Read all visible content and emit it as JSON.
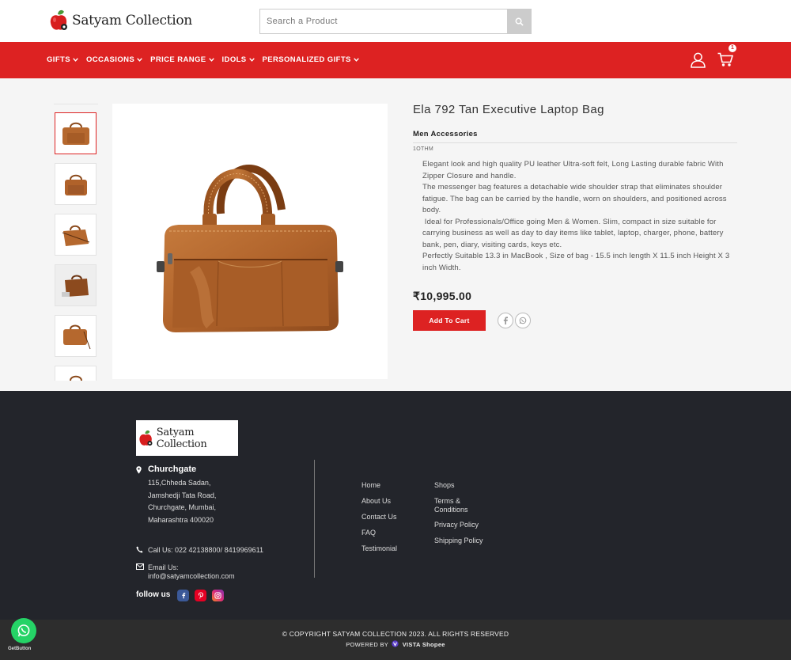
{
  "header": {
    "logo_text": "Satyam Collection",
    "search_placeholder": "Search a Product",
    "cart_count": "1"
  },
  "nav": {
    "items": [
      {
        "label": "GIFTS"
      },
      {
        "label": "OCCASIONS"
      },
      {
        "label": "PRICE RANGE"
      },
      {
        "label": "IDOLS"
      },
      {
        "label": "PERSONALIZED GIFTS"
      }
    ]
  },
  "product": {
    "title": "Ela 792 Tan Executive Laptop Bag",
    "category": "Men Accessories",
    "sku": "1OTHM",
    "description": [
      "Elegant look and high quality PU leather Ultra-soft felt, Long Lasting durable fabric With Zipper Closure and handle.",
      "The messenger bag features a detachable wide shoulder strap that eliminates shoulder fatigue. The bag can be carried by the handle, worn on shoulders, and positioned across body.",
      " Ideal for Professionals/Office going Men & Women. Slim, compact in size suitable for carrying business as well as day to day items like tablet, laptop, charger, phone, battery bank, pen, diary, visiting cards, keys etc.",
      "Perfectly Suitable 13.3 in MacBook , Size of bag - 15.5 inch length X 11.5 inch Height X 3 inch Width."
    ],
    "price": "₹10,995.00",
    "add_to_cart_label": "Add To Cart"
  },
  "footer": {
    "logo_text": "Satyam Collection",
    "address_title": "Churchgate",
    "address_lines": [
      "115,Chheda Sadan,",
      "Jamshedji Tata Road,",
      "Churchgate, Mumbai,",
      "Maharashtra 400020"
    ],
    "call": "Call Us: 022 42138800/ 8419969611",
    "email_label": "Email Us:",
    "email": "info@satyamcollection.com",
    "follow_label": "follow us",
    "links_col1": [
      "Home",
      "About Us",
      "Contact Us",
      "FAQ",
      "Testimonial"
    ],
    "links_col2": [
      "Shops",
      "Terms &",
      "Conditions",
      "Privacy Policy",
      "Shipping Policy"
    ],
    "copyright": "© COPYRIGHT SATYAM COLLECTION 2023. ALL RIGHTS RESERVED",
    "powered_by": "POWERED BY",
    "powered_brand": "VISTA Shopee",
    "getbutton": "GetButton"
  },
  "colors": {
    "brand_red": "#dd2222",
    "footer_bg": "#23252b",
    "bag_tan": "#b5682e",
    "whatsapp_green": "#25d366"
  }
}
